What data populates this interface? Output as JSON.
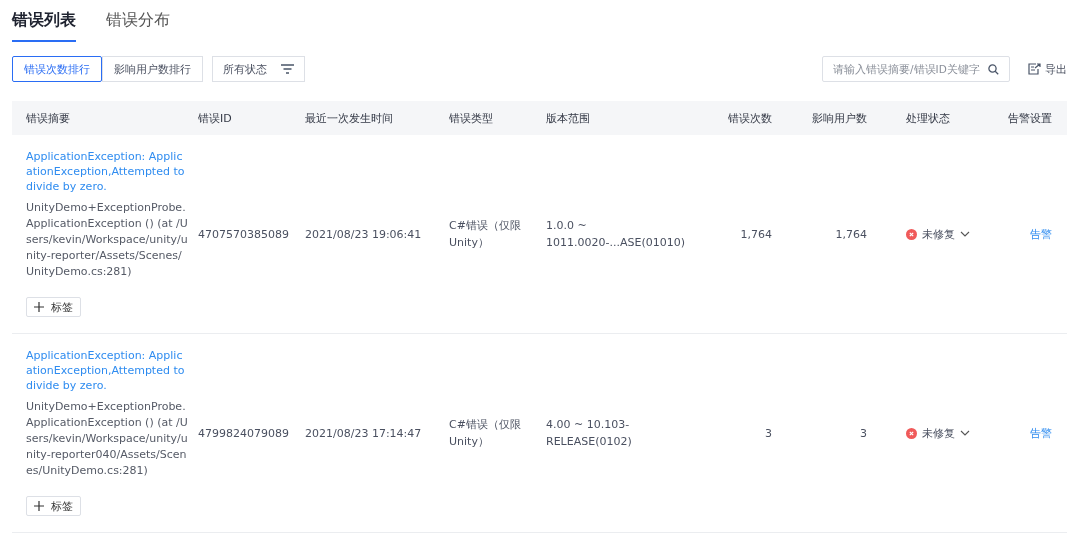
{
  "tabs": [
    {
      "label": "错误列表",
      "selected": true
    },
    {
      "label": "错误分布",
      "selected": false
    }
  ],
  "sort_buttons": [
    {
      "label": "错误次数排行",
      "selected": true
    },
    {
      "label": "影响用户数排行",
      "selected": false
    }
  ],
  "status_filter": {
    "label": "所有状态"
  },
  "search": {
    "placeholder": "请输入错误摘要/错误ID关键字"
  },
  "export_button": {
    "label": "导出"
  },
  "table": {
    "columns": [
      "错误摘要",
      "错误ID",
      "最近一次发生时间",
      "错误类型",
      "版本范围",
      "错误次数",
      "影响用户数",
      "处理状态",
      "告警设置"
    ],
    "rows": [
      {
        "title": "ApplicationException: ApplicationException,Attempted to divide by zero.",
        "stack": "UnityDemo+ExceptionProbe.ApplicationException () (at /Users/kevin/Workspace/unity/unity-reporter/Assets/Scenes/UnityDemo.cs:281)",
        "tag_button": "标签",
        "id": "4707570385089",
        "last_time": "2021/08/23 19:06:41",
        "type": "C#错误（仅限Unity）",
        "versions": "1.0.0 ~ 1011.0020-...ASE(01010)",
        "count": "1,764",
        "users": "1,764",
        "status": "未修复",
        "alert": "告警"
      },
      {
        "title": "ApplicationException: ApplicationException,Attempted to divide by zero.",
        "stack": "UnityDemo+ExceptionProbe.ApplicationException () (at /Users/kevin/Workspace/unity/unity-reporter040/Assets/Scenes/UnityDemo.cs:281)",
        "tag_button": "标签",
        "id": "4799824079089",
        "last_time": "2021/08/23 17:14:47",
        "type": "C#错误（仅限Unity）",
        "versions": "4.00 ~ 10.103-RELEASE(0102)",
        "count": "3",
        "users": "3",
        "status": "未修复",
        "alert": "告警"
      }
    ]
  }
}
